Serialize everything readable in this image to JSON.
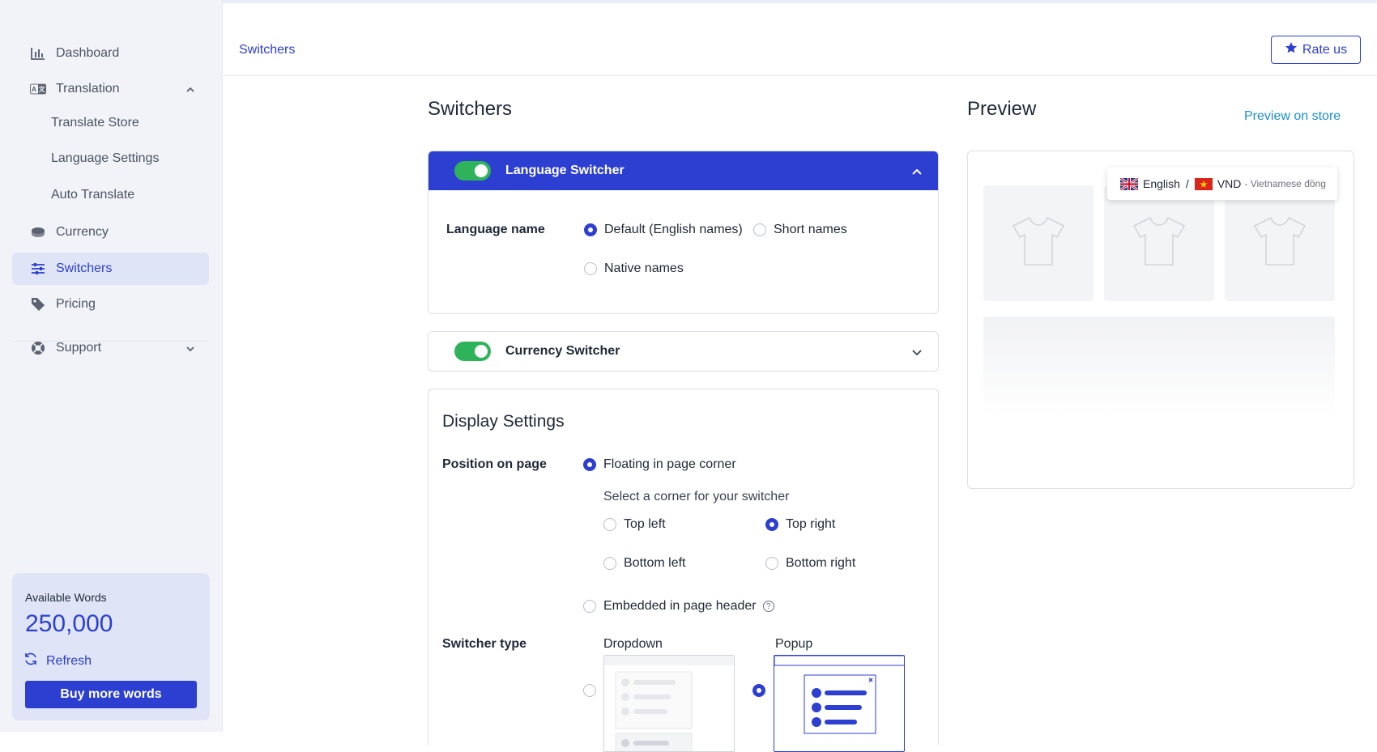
{
  "sidebar": {
    "items": [
      {
        "label": "Dashboard",
        "icon": "bar-chart-icon"
      },
      {
        "label": "Translation",
        "icon": "translate-icon"
      },
      {
        "label": "Translate Store"
      },
      {
        "label": "Language Settings"
      },
      {
        "label": "Auto Translate"
      },
      {
        "label": "Currency",
        "icon": "coins-icon"
      },
      {
        "label": "Switchers",
        "icon": "sliders-icon"
      },
      {
        "label": "Pricing",
        "icon": "tag-icon"
      },
      {
        "label": "Support",
        "icon": "lifebuoy-icon"
      }
    ],
    "words": {
      "label": "Available Words",
      "count": "250,000",
      "refresh": "Refresh",
      "buy": "Buy more words"
    }
  },
  "header": {
    "breadcrumb": "Switchers",
    "rate_us": "Rate us"
  },
  "main": {
    "title": "Switchers",
    "language_switcher": {
      "title": "Language Switcher",
      "field_label": "Language name",
      "options": [
        "Default (English names)",
        "Short names",
        "Native names"
      ],
      "selected": "Default (English names)"
    },
    "currency_switcher": {
      "title": "Currency Switcher"
    },
    "display_settings": {
      "title": "Display Settings",
      "position_label": "Position on page",
      "floating_option": "Floating in page corner",
      "corner_hint": "Select a corner for your switcher",
      "corners": [
        "Top left",
        "Top right",
        "Bottom left",
        "Bottom right"
      ],
      "selected_corner": "Top right",
      "embedded_option": "Embedded in page header",
      "type_label": "Switcher type",
      "types": [
        "Dropdown",
        "Popup"
      ],
      "selected_type": "Popup"
    }
  },
  "preview": {
    "title": "Preview",
    "link": "Preview on store",
    "language": "English",
    "separator": "/",
    "currency_code": "VND",
    "currency_name": "- Vietnamese đồng"
  },
  "colors": {
    "accent": "#2c3fd1",
    "toggle_on": "#2fb35a",
    "link": "#1a8fd1",
    "sidebar_bg": "#f1f3f9"
  }
}
